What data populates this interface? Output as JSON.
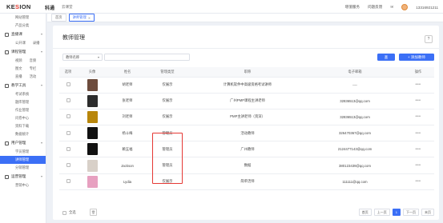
{
  "brand": {
    "logo_prefix": "KE",
    "logo_o": "S",
    "logo_suffix": "ION",
    "name_cn": "科通",
    "tagline": "云课堂"
  },
  "topbar": {
    "course_mall": "增值服务",
    "feedback": "问题反馈",
    "user": "13316921211"
  },
  "sidebar": {
    "items": [
      {
        "label": "网站管理",
        "type": "sub"
      },
      {
        "label": "产品分类",
        "type": "sub"
      },
      {
        "label": "直播课",
        "type": "sec"
      },
      {
        "label": "公开课",
        "label2": "录播",
        "type": "sub2"
      },
      {
        "label": "课程管理",
        "type": "sec"
      },
      {
        "label": "视频",
        "label2": "音频",
        "type": "sub2"
      },
      {
        "label": "图文",
        "label2": "专栏",
        "type": "sub2"
      },
      {
        "label": "直播",
        "label2": "活动",
        "type": "sub2"
      },
      {
        "label": "教学工具",
        "type": "sec"
      },
      {
        "label": "考试系统",
        "type": "sub"
      },
      {
        "label": "题库管理",
        "type": "sub"
      },
      {
        "label": "作业管理",
        "type": "sub"
      },
      {
        "label": "问卷中心",
        "type": "sub"
      },
      {
        "label": "资料下载",
        "type": "sub"
      },
      {
        "label": "数据统计",
        "type": "sub"
      },
      {
        "label": "用户管理",
        "type": "sec"
      },
      {
        "label": "学员管理",
        "type": "sub"
      },
      {
        "label": "讲师管理",
        "type": "sub",
        "active": true
      },
      {
        "label": "分销管理",
        "type": "sub"
      },
      {
        "label": "运营管理",
        "type": "sec"
      },
      {
        "label": "营销中心",
        "type": "sub"
      }
    ]
  },
  "tabs": [
    {
      "label": "首页",
      "active": false
    },
    {
      "label": "讲师管理",
      "active": true
    }
  ],
  "page": {
    "title": "教师管理",
    "help": "?",
    "filter_select": "教师名称",
    "search_btn": "查",
    "add_btn": "+ 添加教师"
  },
  "table": {
    "headers": [
      "选项",
      "头像",
      "姓名",
      "管理类型",
      "职称",
      "电子邮箱",
      "操作"
    ],
    "rows": [
      {
        "name": "胡老师",
        "type": "仅展示",
        "title": "计算机软件中高级资格考试讲师",
        "email": "----",
        "avatar": "#6d4c3d",
        "ops": "•••"
      },
      {
        "name": "张老师",
        "type": "仅展示",
        "title": "广州PMP课程主讲老师",
        "email": "32836513@qq.com",
        "avatar": "#2c2c2c",
        "ops": "•••"
      },
      {
        "name": "刘老师",
        "type": "仅展示",
        "title": "PMP主讲老师（资深）",
        "email": "32836513@qq.com",
        "avatar": "#b8860b",
        "ops": "•••"
      },
      {
        "name": "杨斗梅",
        "type": "管理员",
        "title": "活动教师",
        "email": "326470367@qq.com",
        "avatar": "#111111",
        "ops": "•••"
      },
      {
        "name": "赖五福",
        "type": "管理员",
        "title": "广州教师",
        "email": "2124477143@qq.com",
        "avatar": "#111111",
        "ops": "•••"
      },
      {
        "name": "Jackson",
        "type": "管理员",
        "title": "数据",
        "email": "380123439@qq.com",
        "avatar": "#d8d0c8",
        "ops": "•••"
      },
      {
        "name": "Lydia",
        "type": "仅展示",
        "title": "简单活师",
        "email": "111111@qq.com",
        "avatar": "#e7a0c0",
        "ops": "•••"
      }
    ]
  },
  "footer": {
    "select_all": "全选",
    "delete_icon": "🗑",
    "pager": [
      "首页",
      "上一页",
      "1",
      "下一页",
      "末页"
    ],
    "current_page": "1"
  },
  "colors": {
    "primary": "#3b6ff6",
    "highlight_box": "#e53935"
  }
}
